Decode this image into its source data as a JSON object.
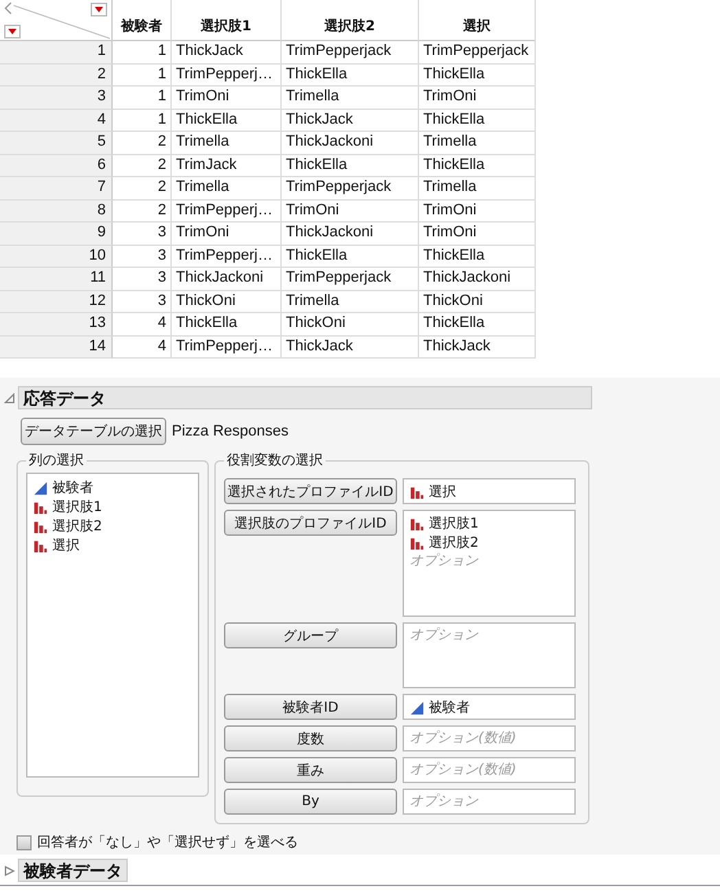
{
  "table": {
    "columns": [
      "被験者",
      "選択肢1",
      "選択肢2",
      "選択"
    ],
    "rows": [
      {
        "n": "1",
        "cells": [
          "1",
          "ThickJack",
          "TrimPepperjack",
          "TrimPepperjack"
        ]
      },
      {
        "n": "2",
        "cells": [
          "1",
          "TrimPepperj…",
          "ThickElla",
          "ThickElla"
        ]
      },
      {
        "n": "3",
        "cells": [
          "1",
          "TrimOni",
          "Trimella",
          "TrimOni"
        ]
      },
      {
        "n": "4",
        "cells": [
          "1",
          "ThickElla",
          "ThickJack",
          "ThickElla"
        ]
      },
      {
        "n": "5",
        "cells": [
          "2",
          "Trimella",
          "ThickJackoni",
          "Trimella"
        ]
      },
      {
        "n": "6",
        "cells": [
          "2",
          "TrimJack",
          "ThickElla",
          "ThickElla"
        ]
      },
      {
        "n": "7",
        "cells": [
          "2",
          "Trimella",
          "TrimPepperjack",
          "Trimella"
        ]
      },
      {
        "n": "8",
        "cells": [
          "2",
          "TrimPepperj…",
          "TrimOni",
          "TrimOni"
        ]
      },
      {
        "n": "9",
        "cells": [
          "3",
          "TrimOni",
          "ThickJackoni",
          "TrimOni"
        ]
      },
      {
        "n": "10",
        "cells": [
          "3",
          "TrimPepperj…",
          "ThickElla",
          "ThickElla"
        ]
      },
      {
        "n": "11",
        "cells": [
          "3",
          "ThickJackoni",
          "TrimPepperjack",
          "ThickJackoni"
        ]
      },
      {
        "n": "12",
        "cells": [
          "3",
          "ThickOni",
          "Trimella",
          "ThickOni"
        ]
      },
      {
        "n": "13",
        "cells": [
          "4",
          "ThickElla",
          "ThickOni",
          "ThickElla"
        ]
      },
      {
        "n": "14",
        "cells": [
          "4",
          "TrimPepperj…",
          "ThickJack",
          "ThickJack"
        ]
      }
    ]
  },
  "response_section": {
    "title": "応答データ",
    "expanded": true,
    "table_button": "データテーブルの選択",
    "table_name": "Pizza Responses",
    "columns_group": {
      "title": "列の選択",
      "items": [
        {
          "label": "被験者",
          "kind": "continuous"
        },
        {
          "label": "選択肢1",
          "kind": "nominal"
        },
        {
          "label": "選択肢2",
          "kind": "nominal"
        },
        {
          "label": "選択",
          "kind": "nominal"
        }
      ]
    },
    "roles_group": {
      "title": "役割変数の選択",
      "roles": [
        {
          "button": "選択されたプロファイルID",
          "kind": "single",
          "items": [
            {
              "label": "選択",
              "kind": "nominal"
            }
          ]
        },
        {
          "button": "選択肢のプロファイルID",
          "kind": "tall",
          "items": [
            {
              "label": "選択肢1",
              "kind": "nominal"
            },
            {
              "label": "選択肢2",
              "kind": "nominal"
            }
          ],
          "placeholder": "オプション"
        },
        {
          "button": "グループ",
          "kind": "medium",
          "placeholder": "オプション"
        },
        {
          "button": "被験者ID",
          "kind": "single",
          "items": [
            {
              "label": "被験者",
              "kind": "continuous"
            }
          ]
        },
        {
          "button": "度数",
          "kind": "single",
          "placeholder": "オプション(数値)"
        },
        {
          "button": "重み",
          "kind": "single",
          "placeholder": "オプション(数値)"
        },
        {
          "button": "By",
          "kind": "single",
          "placeholder": "オプション"
        }
      ]
    }
  },
  "none_option": {
    "label": "回答者が「なし」や「選択せず」を選べる",
    "checked": false
  },
  "subject_section": {
    "title": "被験者データ",
    "expanded": false
  }
}
